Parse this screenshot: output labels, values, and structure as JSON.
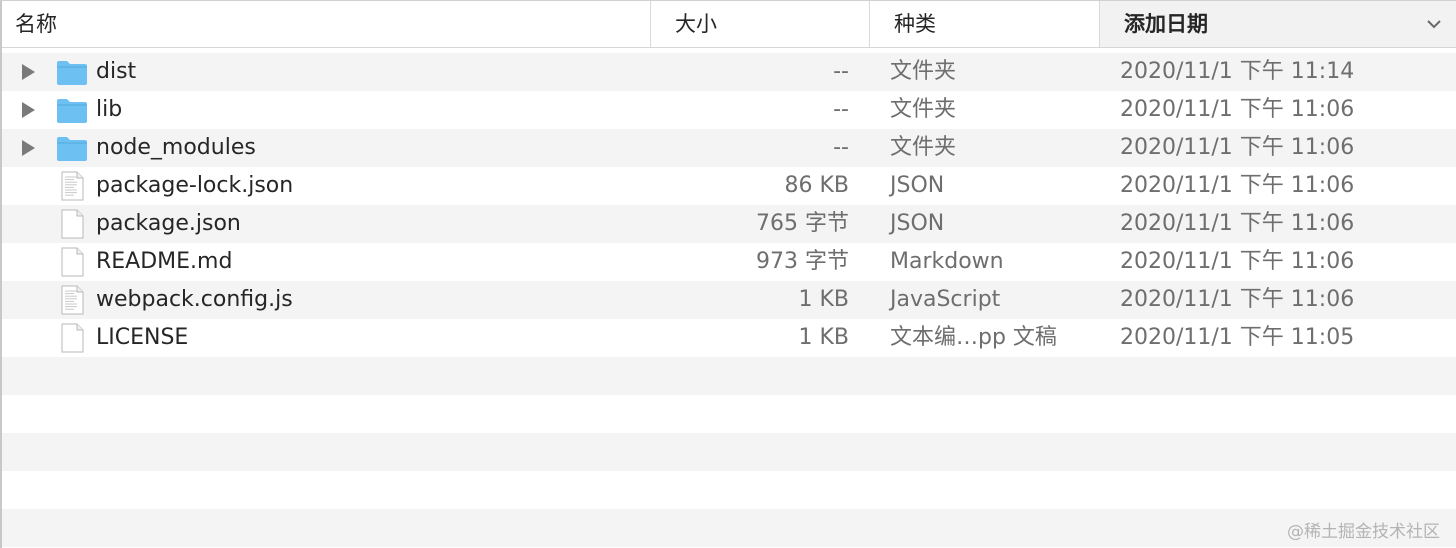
{
  "columns": {
    "name": "名称",
    "size": "大小",
    "kind": "种类",
    "date": "添加日期"
  },
  "files": [
    {
      "name": "dist",
      "size": "--",
      "kind": "文件夹",
      "date": "2020/11/1 下午 11:14",
      "icon": "folder-icon",
      "expandable": true
    },
    {
      "name": "lib",
      "size": "--",
      "kind": "文件夹",
      "date": "2020/11/1 下午 11:06",
      "icon": "folder-icon",
      "expandable": true
    },
    {
      "name": "node_modules",
      "size": "--",
      "kind": "文件夹",
      "date": "2020/11/1 下午 11:06",
      "icon": "folder-icon",
      "expandable": true
    },
    {
      "name": "package-lock.json",
      "size": "86 KB",
      "kind": "JSON",
      "date": "2020/11/1 下午 11:06",
      "icon": "text-document-icon",
      "expandable": false
    },
    {
      "name": "package.json",
      "size": "765 字节",
      "kind": "JSON",
      "date": "2020/11/1 下午 11:06",
      "icon": "blank-document-icon",
      "expandable": false
    },
    {
      "name": "README.md",
      "size": "973 字节",
      "kind": "Markdown",
      "date": "2020/11/1 下午 11:06",
      "icon": "blank-document-icon",
      "expandable": false
    },
    {
      "name": "webpack.config.js",
      "size": "1 KB",
      "kind": "JavaScript",
      "date": "2020/11/1 下午 11:06",
      "icon": "text-document-icon",
      "expandable": false
    },
    {
      "name": "LICENSE",
      "size": "1 KB",
      "kind": "文本编…pp 文稿",
      "date": "2020/11/1 下午 11:05",
      "icon": "blank-document-icon",
      "expandable": false
    }
  ],
  "watermark": "@稀土掘金技术社区",
  "colors": {
    "folder": "#6cc1f2",
    "alt_row": "#f4f4f5",
    "secondary_text": "#6e6e6e"
  }
}
